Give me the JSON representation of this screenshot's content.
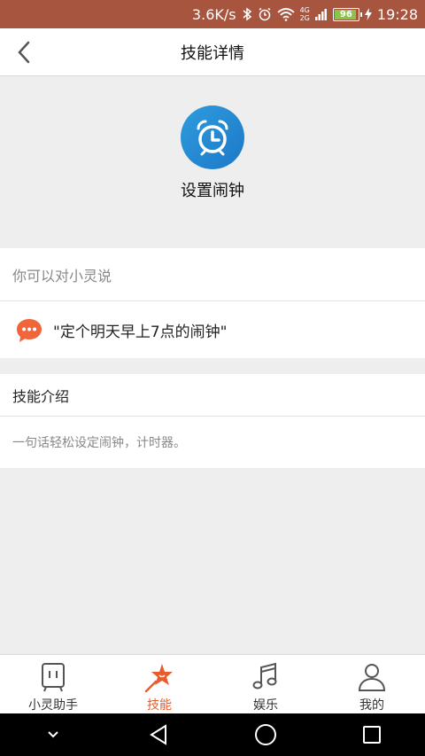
{
  "status_bar": {
    "net_speed": "3.6K/s",
    "net_type_top": "4G",
    "net_type_bottom": "2G",
    "battery": "96",
    "time": "19:28"
  },
  "header": {
    "title": "技能详情",
    "back_icon": "chevron-left-icon"
  },
  "skill": {
    "name": "设置闹钟",
    "icon": "alarm-clock-icon",
    "icon_color": "#2a8fd6"
  },
  "say_section": {
    "heading": "你可以对小灵说",
    "example": "\"定个明天早上7点的闹钟\"",
    "bubble_color": "#f0653a"
  },
  "intro_section": {
    "heading": "技能介绍",
    "text": "一句话轻松设定闹钟，计时器。"
  },
  "tabs": [
    {
      "label": "小灵助手",
      "icon": "assistant-icon",
      "active": false
    },
    {
      "label": "技能",
      "icon": "skill-star-icon",
      "active": true
    },
    {
      "label": "娱乐",
      "icon": "music-note-icon",
      "active": false
    },
    {
      "label": "我的",
      "icon": "user-icon",
      "active": false
    }
  ],
  "accent_color": "#e85c2d"
}
